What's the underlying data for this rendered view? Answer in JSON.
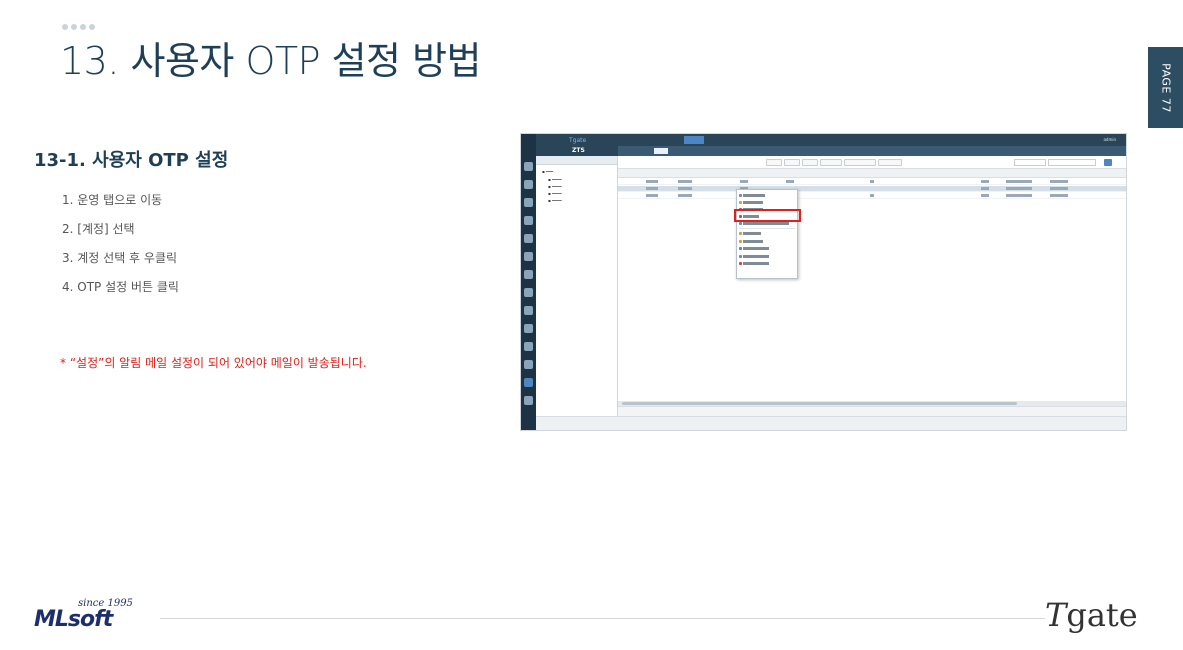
{
  "header": {
    "title": "13. 사용자 OTP 설정 방법",
    "page_label": "PAGE 77"
  },
  "section": {
    "subtitle": "13-1. 사용자 OTP 설정",
    "steps": [
      "1.   운영 탭으로 이동",
      "2.   [계정] 선택",
      "3.   계정 선택 후 우클릭",
      "4.   OTP 설정 버튼 클릭"
    ],
    "note": "* “설정”의 알림 메일 설정이 되어 있어야 메일이 발송됩니다."
  },
  "footer": {
    "ml_since": "since 1995",
    "ml_brand": "MLsoft",
    "tgate_initial": "T",
    "tgate_rest": "gate"
  },
  "colors": {
    "title": "#1f3f57",
    "page_tab": "#2d4e62",
    "note": "#e0201a",
    "highlight_box": "#e0201a"
  }
}
